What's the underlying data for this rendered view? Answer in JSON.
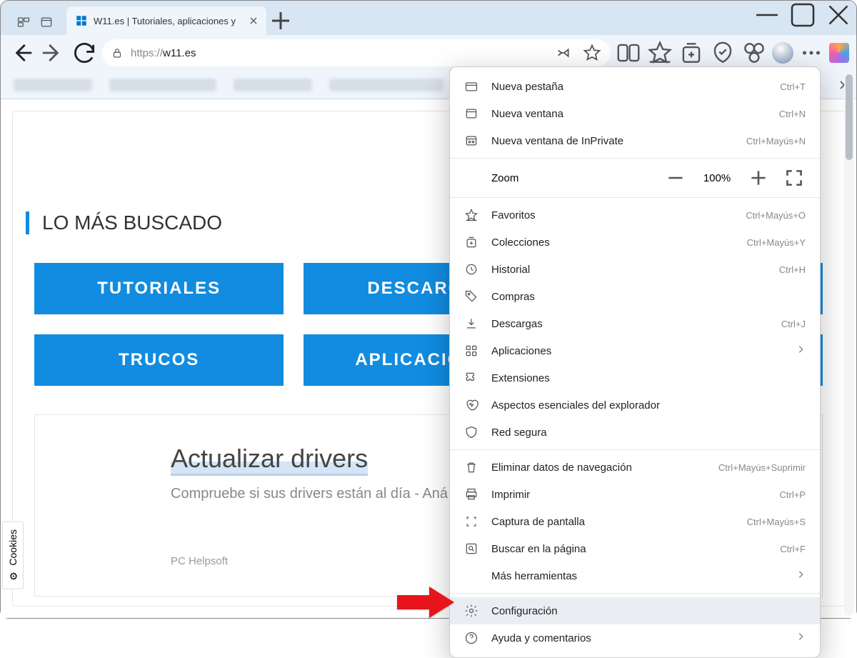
{
  "tab": {
    "title": "W11.es | Tutoriales, aplicaciones y"
  },
  "url": {
    "protocol": "https://",
    "host": "w11.es"
  },
  "page": {
    "section_title": "LO MÁS BUSCADO",
    "buttons": [
      "TUTORIALES",
      "DESCARGAS",
      "——",
      "TRUCOS",
      "APLICACIONES",
      "——"
    ],
    "card": {
      "title": "Actualizar drivers",
      "subtitle": "Compruebe si sus drivers están al día - Aná",
      "source": "PC Helpsoft"
    }
  },
  "cookies_label": "Cookies",
  "menu": {
    "zoom_label": "Zoom",
    "zoom_value": "100%",
    "items_top": [
      {
        "label": "Nueva pestaña",
        "shortcut": "Ctrl+T",
        "icon": "tab"
      },
      {
        "label": "Nueva ventana",
        "shortcut": "Ctrl+N",
        "icon": "window"
      },
      {
        "label": "Nueva ventana de InPrivate",
        "shortcut": "Ctrl+Mayús+N",
        "icon": "private"
      }
    ],
    "items_mid": [
      {
        "label": "Favoritos",
        "shortcut": "Ctrl+Mayús+O",
        "icon": "star"
      },
      {
        "label": "Colecciones",
        "shortcut": "Ctrl+Mayús+Y",
        "icon": "collections"
      },
      {
        "label": "Historial",
        "shortcut": "Ctrl+H",
        "icon": "history"
      },
      {
        "label": "Compras",
        "shortcut": "",
        "icon": "tag"
      },
      {
        "label": "Descargas",
        "shortcut": "Ctrl+J",
        "icon": "download"
      },
      {
        "label": "Aplicaciones",
        "shortcut": "",
        "icon": "apps",
        "submenu": true
      },
      {
        "label": "Extensiones",
        "shortcut": "",
        "icon": "puzzle"
      },
      {
        "label": "Aspectos esenciales del explorador",
        "shortcut": "",
        "icon": "pulse"
      },
      {
        "label": "Red segura",
        "shortcut": "",
        "icon": "shield"
      }
    ],
    "items_low": [
      {
        "label": "Eliminar datos de navegación",
        "shortcut": "Ctrl+Mayús+Suprimir",
        "icon": "trash"
      },
      {
        "label": "Imprimir",
        "shortcut": "Ctrl+P",
        "icon": "print"
      },
      {
        "label": "Captura de pantalla",
        "shortcut": "Ctrl+Mayús+S",
        "icon": "screenshot"
      },
      {
        "label": "Buscar en la página",
        "shortcut": "Ctrl+F",
        "icon": "find"
      },
      {
        "label": "Más herramientas",
        "shortcut": "",
        "icon": "",
        "submenu": true
      }
    ],
    "items_bottom": [
      {
        "label": "Configuración",
        "shortcut": "",
        "icon": "gear",
        "highlighted": true
      },
      {
        "label": "Ayuda y comentarios",
        "shortcut": "",
        "icon": "help",
        "submenu": true
      }
    ]
  }
}
